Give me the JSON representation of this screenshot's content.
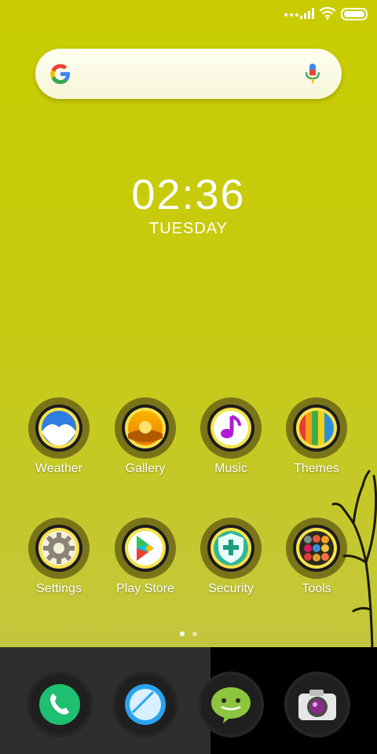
{
  "status_bar": {
    "icons": [
      "signal-dots-icon",
      "cell-signal-icon",
      "wifi-icon",
      "battery-icon"
    ]
  },
  "search_widget": {
    "logo": "google-g-icon",
    "mic_icon": "microphone-icon"
  },
  "clock_widget": {
    "time": "02:36",
    "day": "TUESDAY"
  },
  "apps": [
    {
      "label": "Weather",
      "icon": "weather-icon"
    },
    {
      "label": "Gallery",
      "icon": "gallery-icon"
    },
    {
      "label": "Music",
      "icon": "music-icon"
    },
    {
      "label": "Themes",
      "icon": "themes-icon"
    },
    {
      "label": "Settings",
      "icon": "settings-gear-icon"
    },
    {
      "label": "Play Store",
      "icon": "play-store-icon"
    },
    {
      "label": "Security",
      "icon": "security-shield-icon"
    },
    {
      "label": "Tools",
      "icon": "tools-folder-icon"
    }
  ],
  "page_indicator": {
    "pages": 2,
    "active": 1
  },
  "dock": [
    {
      "icon": "phone-icon"
    },
    {
      "icon": "browser-icon"
    },
    {
      "icon": "messaging-icon"
    },
    {
      "icon": "camera-icon"
    }
  ],
  "colors": {
    "wallpaper": "#c9cc00",
    "ring": "#7a7419",
    "dock_left": "#2e2e2e",
    "dock_right": "#000000"
  }
}
